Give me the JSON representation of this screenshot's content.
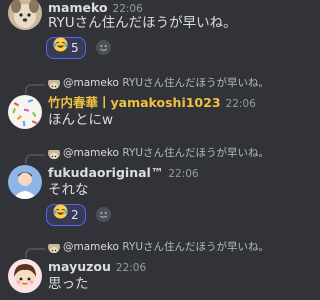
{
  "messages": [
    {
      "author": "mameko",
      "time": "22:06",
      "text": "RYUさん住んだほうが早いね。",
      "author_color": "#f2f3f5",
      "avatar_icon": "dog-avatar-icon",
      "reaction": {
        "emoji_icon": "laughing-tears-emoji",
        "count": "5"
      }
    },
    {
      "reply": {
        "author": "@mameko",
        "text": "RYUさん住んだほうが早いね。"
      },
      "author": "竹内春華丨yamakoshi1023",
      "time": "22:06",
      "text": "ほんとにw",
      "author_color": "#f0c040",
      "avatar_icon": "sprinkle-donut-avatar-icon"
    },
    {
      "reply": {
        "author": "@mameko",
        "text": "RYUさん住んだほうが早いね。"
      },
      "author": "fukudaoriginal™",
      "time": "22:06",
      "text": "それな",
      "author_color": "#f2f3f5",
      "avatar_icon": "person-avatar-icon",
      "reaction": {
        "emoji_icon": "laughing-tears-emoji",
        "count": "2"
      }
    },
    {
      "reply": {
        "author": "@mameko",
        "text": "RYUさん住んだほうが早いね。"
      },
      "author": "mayuzou",
      "time": "22:06",
      "text": "思った",
      "author_color": "#f2f3f5",
      "avatar_icon": "girl-avatar-icon"
    }
  ],
  "colors": {
    "background": "#313338",
    "reaction_border": "#5865f2",
    "timestamp": "#949ba4"
  }
}
